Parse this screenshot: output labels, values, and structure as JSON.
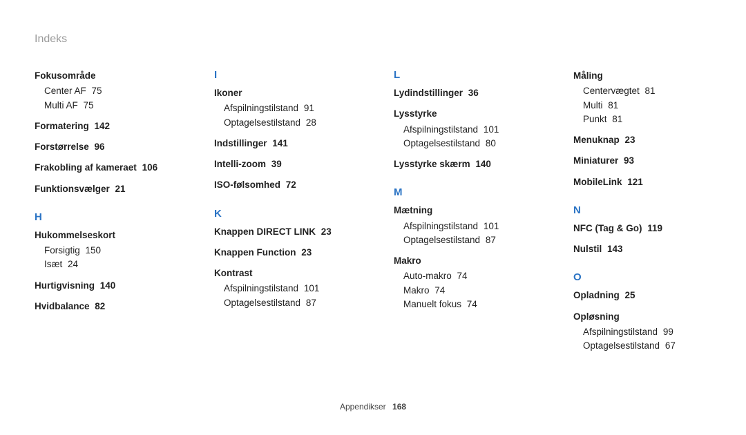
{
  "title": "Indeks",
  "footer": {
    "label": "Appendikser",
    "page": "168"
  },
  "columns": [
    [
      {
        "type": "entry",
        "label": "Fokusområde",
        "subs": [
          {
            "label": "Center AF",
            "page": "75"
          },
          {
            "label": "Multi AF",
            "page": "75"
          }
        ]
      },
      {
        "type": "entry",
        "label": "Formatering",
        "page": "142",
        "bold_page": true
      },
      {
        "type": "entry",
        "label": "Forstørrelse",
        "page": "96",
        "bold_page": true
      },
      {
        "type": "entry",
        "label": "Frakobling af kameraet",
        "page": "106",
        "bold_page": true
      },
      {
        "type": "entry",
        "label": "Funktionsvælger",
        "page": "21",
        "bold_page": true
      },
      {
        "type": "letter",
        "text": "H"
      },
      {
        "type": "entry",
        "label": "Hukommelseskort",
        "subs": [
          {
            "label": "Forsigtig",
            "page": "150"
          },
          {
            "label": "Isæt",
            "page": "24"
          }
        ]
      },
      {
        "type": "entry",
        "label": "Hurtigvisning",
        "page": "140",
        "bold_page": true
      },
      {
        "type": "entry",
        "label": "Hvidbalance",
        "page": "82",
        "bold_page": true
      }
    ],
    [
      {
        "type": "letter",
        "text": "I"
      },
      {
        "type": "entry",
        "label": "Ikoner",
        "subs": [
          {
            "label": "Afspilningstilstand",
            "page": "91"
          },
          {
            "label": "Optagelsestilstand",
            "page": "28"
          }
        ]
      },
      {
        "type": "entry",
        "label": "Indstillinger",
        "page": "141",
        "bold_page": true
      },
      {
        "type": "entry",
        "label": "Intelli-zoom",
        "page": "39",
        "bold_page": true
      },
      {
        "type": "entry",
        "label": "ISO-følsomhed",
        "page": "72",
        "bold_page": true
      },
      {
        "type": "letter",
        "text": "K"
      },
      {
        "type": "entry",
        "label": "Knappen DIRECT LINK",
        "page": "23",
        "bold_page": true
      },
      {
        "type": "entry",
        "label": "Knappen Function",
        "page": "23",
        "bold_page": true
      },
      {
        "type": "entry",
        "label": "Kontrast",
        "subs": [
          {
            "label": "Afspilningstilstand",
            "page": "101"
          },
          {
            "label": "Optagelsestilstand",
            "page": "87"
          }
        ]
      }
    ],
    [
      {
        "type": "letter",
        "text": "L"
      },
      {
        "type": "entry",
        "label": "Lydindstillinger",
        "page": "36",
        "bold_page": true
      },
      {
        "type": "entry",
        "label": "Lysstyrke",
        "subs": [
          {
            "label": "Afspilningstilstand",
            "page": "101"
          },
          {
            "label": "Optagelsestilstand",
            "page": "80"
          }
        ]
      },
      {
        "type": "entry",
        "label": "Lysstyrke skærm",
        "page": "140",
        "bold_page": true
      },
      {
        "type": "letter",
        "text": "M"
      },
      {
        "type": "entry",
        "label": "Mætning",
        "subs": [
          {
            "label": "Afspilningstilstand",
            "page": "101"
          },
          {
            "label": "Optagelsestilstand",
            "page": "87"
          }
        ]
      },
      {
        "type": "entry",
        "label": "Makro",
        "subs": [
          {
            "label": "Auto-makro",
            "page": "74"
          },
          {
            "label": "Makro",
            "page": "74"
          },
          {
            "label": "Manuelt fokus",
            "page": "74"
          }
        ]
      }
    ],
    [
      {
        "type": "entry",
        "label": "Måling",
        "subs": [
          {
            "label": "Centervægtet",
            "page": "81"
          },
          {
            "label": "Multi",
            "page": "81"
          },
          {
            "label": "Punkt",
            "page": "81"
          }
        ]
      },
      {
        "type": "entry",
        "label": "Menuknap",
        "page": "23",
        "bold_page": true
      },
      {
        "type": "entry",
        "label": "Miniaturer",
        "page": "93",
        "bold_page": true
      },
      {
        "type": "entry",
        "label": "MobileLink",
        "page": "121",
        "bold_page": true
      },
      {
        "type": "letter",
        "text": "N"
      },
      {
        "type": "entry",
        "label": "NFC (Tag & Go)",
        "page": "119",
        "bold_page": true
      },
      {
        "type": "entry",
        "label": "Nulstil",
        "page": "143",
        "bold_page": true
      },
      {
        "type": "letter",
        "text": "O"
      },
      {
        "type": "entry",
        "label": "Opladning",
        "page": "25",
        "bold_page": true
      },
      {
        "type": "entry",
        "label": "Opløsning",
        "subs": [
          {
            "label": "Afspilningstilstand",
            "page": "99"
          },
          {
            "label": "Optagelsestilstand",
            "page": "67"
          }
        ]
      }
    ]
  ]
}
